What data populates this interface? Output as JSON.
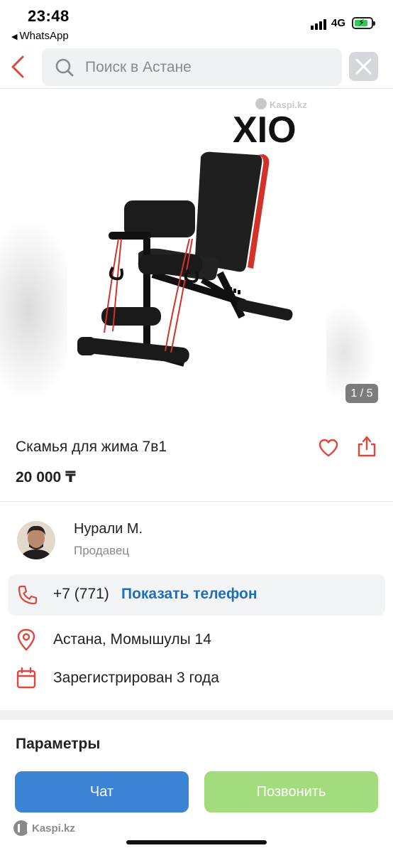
{
  "status_bar": {
    "time": "23:48",
    "back_app": "WhatsApp",
    "network": "4G",
    "icons": [
      "signal-icon",
      "battery-charging-icon"
    ]
  },
  "search": {
    "placeholder": "Поиск в Астане",
    "icons": [
      "back-arrow-icon",
      "search-icon",
      "close-icon"
    ]
  },
  "gallery": {
    "watermark_text": "Kaspi.kz",
    "brand_logo_text": "XIO",
    "counter": "1 / 5"
  },
  "product": {
    "title": "Скамья для жима 7в1",
    "price": "20 000 ₸"
  },
  "seller": {
    "name": "Нурали М.",
    "role": "Продавец"
  },
  "contact": {
    "phone_prefix": "+7 (771)",
    "show_phone_label": "Показать телефон"
  },
  "info": {
    "address": "Астана, Момышулы 14",
    "registered": "Зарегистрирован 3 года"
  },
  "params_title": "Параметры",
  "actions": {
    "chat_label": "Чат",
    "call_label": "Позвонить"
  },
  "footer": {
    "brand": "Kaspi.kz"
  },
  "colors": {
    "accent_red": "#e0463c",
    "link_blue": "#1d70b8",
    "chat_button": "#3b83d3",
    "call_button": "#a3dc7d"
  }
}
